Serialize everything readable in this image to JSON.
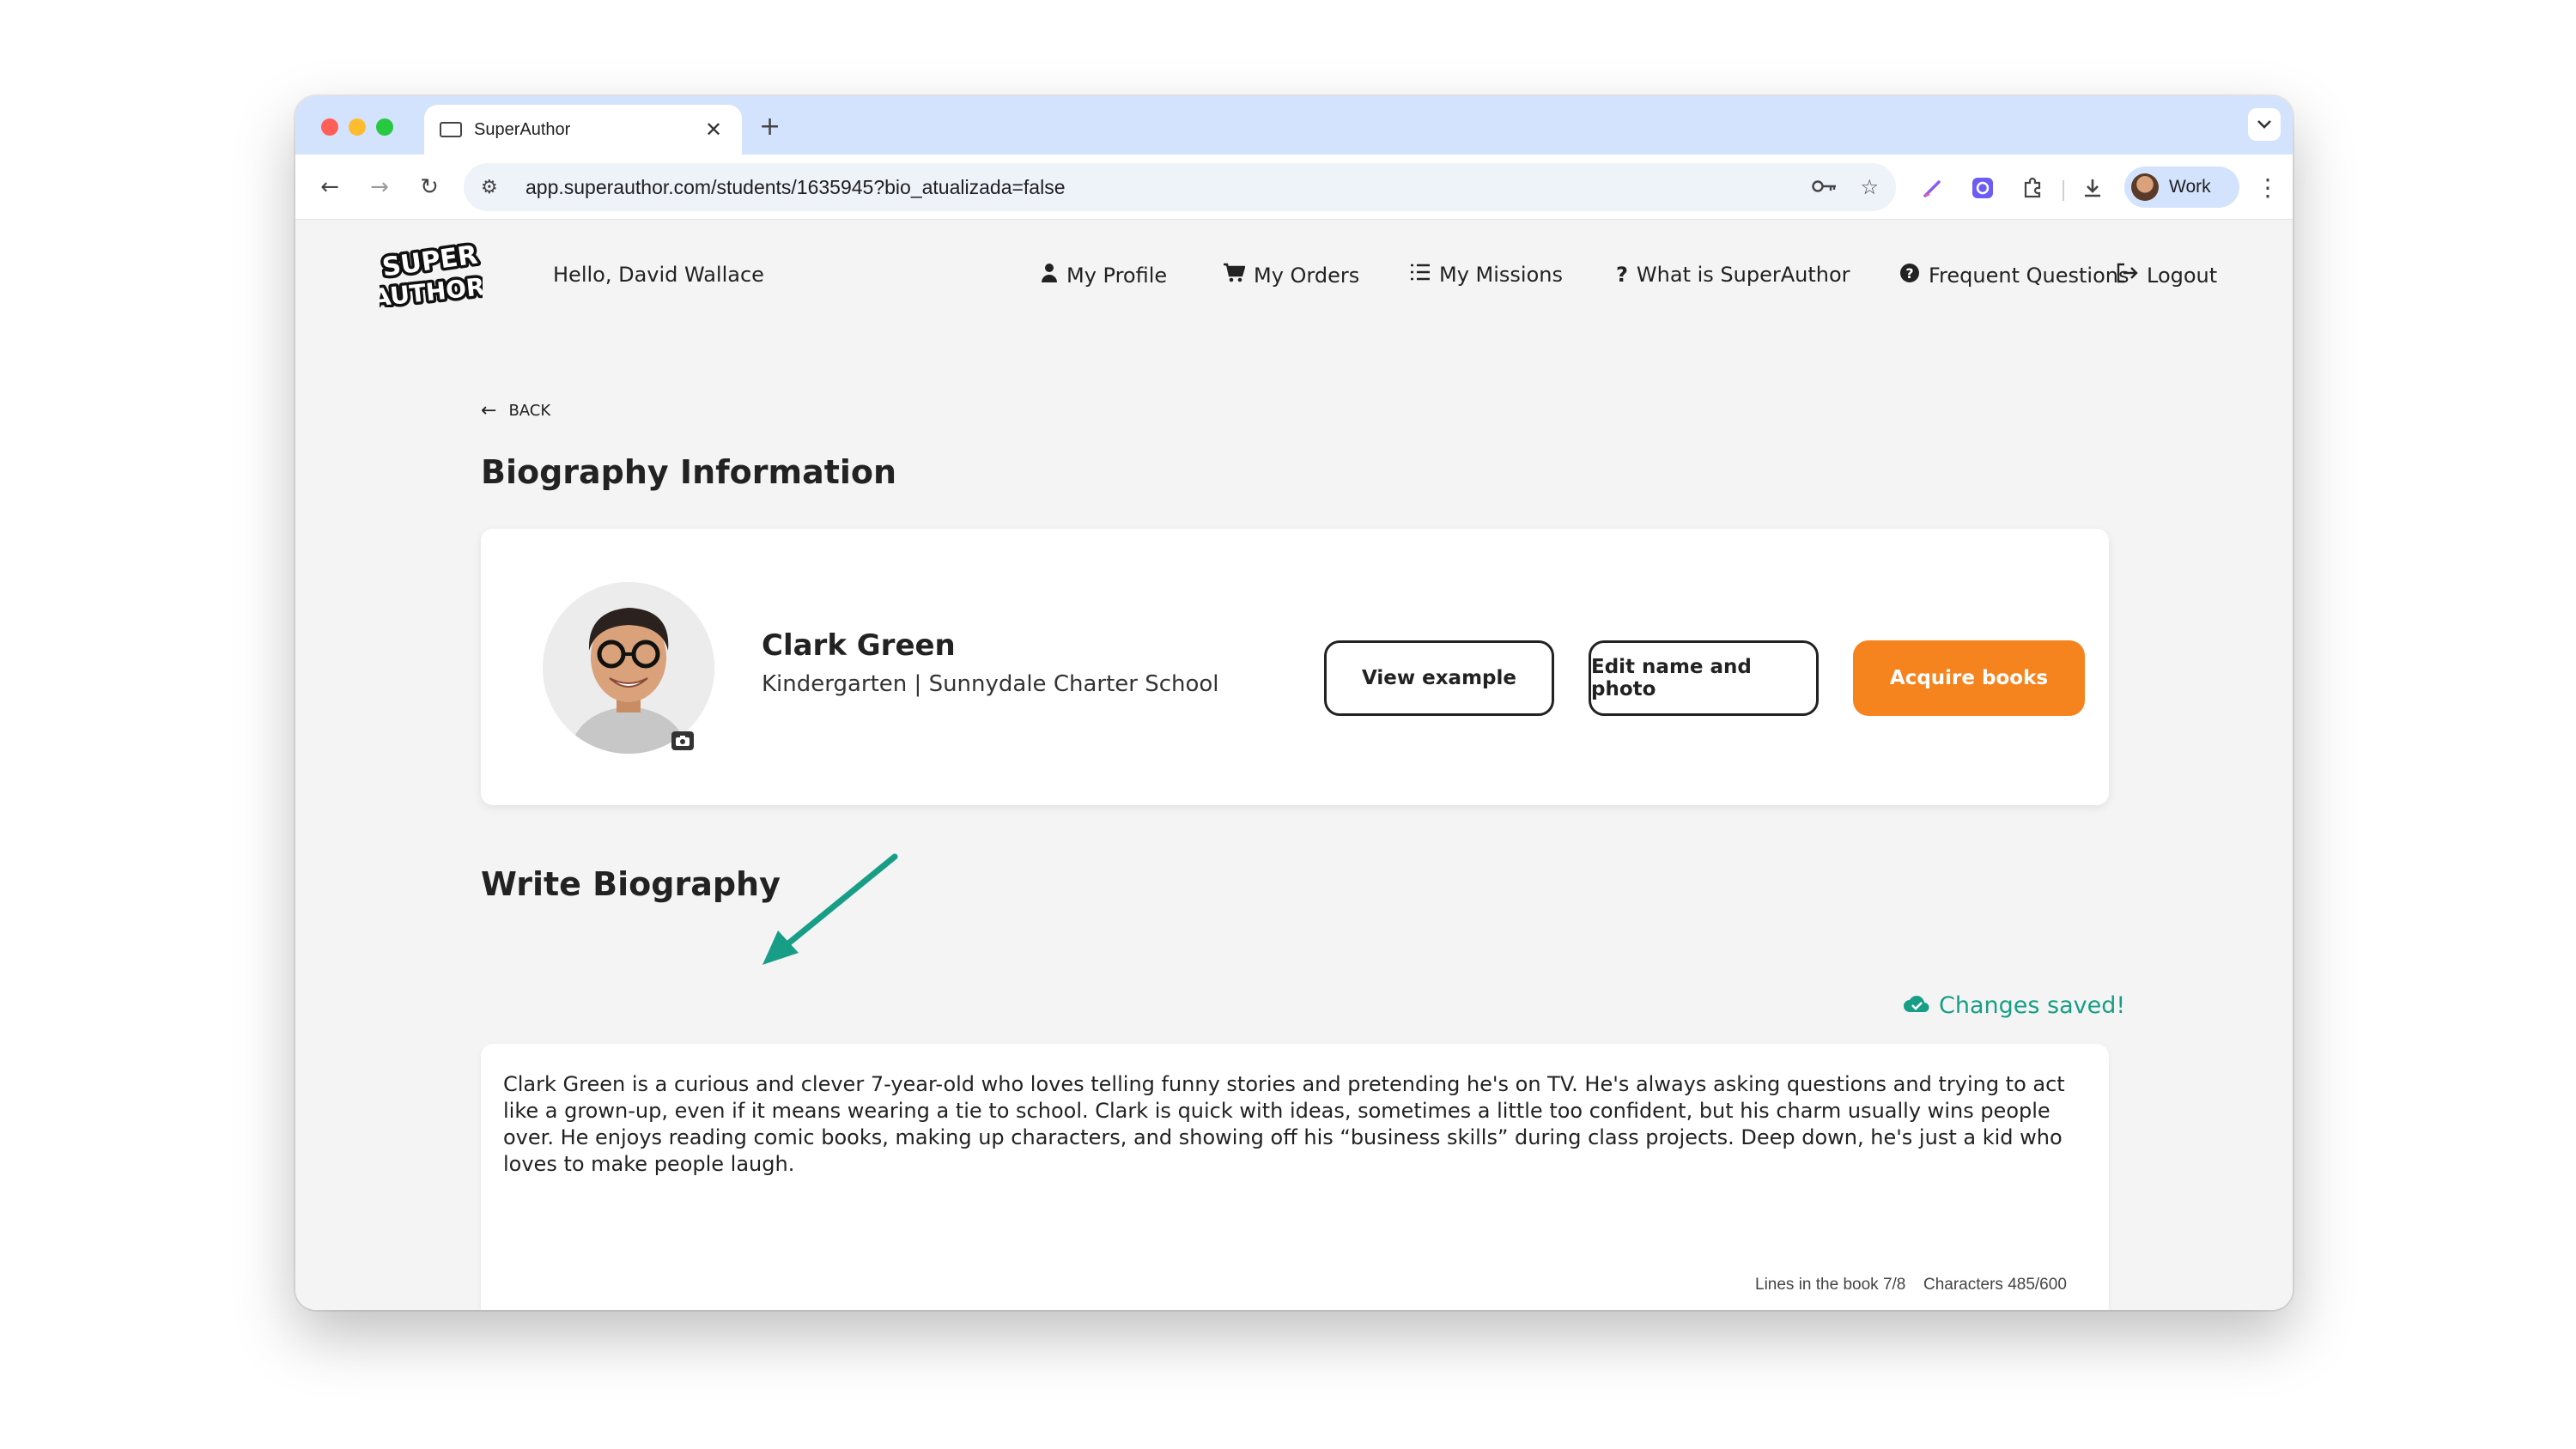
{
  "browser": {
    "tab_title": "SuperAuthor",
    "tab_close": "✕",
    "new_tab": "+",
    "tab_menu_icon": "chevron-down-icon",
    "url": "app.superauthor.com/students/1635945?bio_atualizada=false",
    "profile_name": "Work",
    "traffic_colors": [
      "#ff5f57",
      "#febc2e",
      "#28c840"
    ]
  },
  "header": {
    "logo_line1": "SUPER",
    "logo_line2": "AUTHOR",
    "greeting": "Hello, David Wallace",
    "nav": [
      {
        "label": "My Profile",
        "icon": "user-icon"
      },
      {
        "label": "My Orders",
        "icon": "cart-icon"
      },
      {
        "label": "My Missions",
        "icon": "list-icon"
      },
      {
        "label": "What is SuperAuthor",
        "icon": "question-icon"
      },
      {
        "label": "Frequent Questions",
        "icon": "help-circle-icon"
      },
      {
        "label": "Logout",
        "icon": "logout-icon"
      }
    ]
  },
  "main": {
    "back_label": "BACK",
    "bio_info_title": "Biography Information",
    "student": {
      "name": "Clark Green",
      "info": "Kindergarten | Sunnydale Charter School"
    },
    "buttons": {
      "view_example": "View example",
      "edit_name_photo": "Edit name and photo",
      "acquire_books": "Acquire books"
    },
    "write_bio_title": "Write Biography",
    "saved_status": "Changes saved!",
    "bio_text": "Clark Green is a curious and clever 7-year-old who loves telling funny stories and pretending he's on TV. He's always asking questions and trying to act like a grown-up, even if it means wearing a tie to school. Clark is quick with ideas, sometimes a little too confident, but his charm usually wins people over. He enjoys reading comic books, making up characters, and showing off his “business skills” during class projects. Deep down, he's just a kid who loves to make people laugh.",
    "lines_counter": "Lines in the book 7/8",
    "chars_counter": "Characters 485/600"
  },
  "colors": {
    "accent_orange": "#f5841f",
    "saved_green": "#189e86",
    "annotation_arrow": "#189e86"
  }
}
